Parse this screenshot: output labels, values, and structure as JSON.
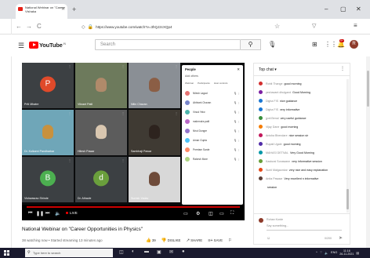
{
  "browser": {
    "tab_title_line1": "National Webinar on \"Career O",
    "tab_title_line2": "Vishaka",
    "new_tab_symbol": "+",
    "url": "https://www.youtube.com/watch?v=3hQJ2cXQp4",
    "window_controls": [
      "–",
      "▢",
      "✕"
    ],
    "nav": [
      "←",
      "→",
      "C"
    ]
  },
  "youtube": {
    "logo_text": "YouTube",
    "logo_country": "IN",
    "search_placeholder": "Search",
    "bell_badge": "9+",
    "avatar_letter": "R"
  },
  "video": {
    "live_label": "LIVE",
    "tiles": [
      {
        "name": "Priti Mhatre",
        "type": "avatar",
        "letter": "P",
        "color": "#e04a2a"
      },
      {
        "name": "Vikrant Patil",
        "type": "video",
        "bg": "#6d7a5c",
        "face": "#b08a6a"
      },
      {
        "name": "Nitin Chavan",
        "type": "video",
        "bg": "#8a8f95",
        "face": "#8b5e45"
      },
      {
        "name": "Dr. Kulkarni Pandharkar",
        "type": "video",
        "bg": "#6fa6b8",
        "face": "#c8913e"
      },
      {
        "name": "Hitesh Pawar",
        "type": "video",
        "bg": "#5c5c5c",
        "face": "#d9c7b0"
      },
      {
        "name": "Sambhaji Pawar",
        "type": "video",
        "bg": "#3f3a33",
        "face": "#2d231e"
      },
      {
        "name": "Vishwasrao Shinde",
        "type": "avatar",
        "letter": "B",
        "color": "#4caf50"
      },
      {
        "name": "Dr. Athavle",
        "type": "avatar",
        "letter": "d",
        "color": "#6a9f3c"
      },
      {
        "name": "Suresh Yadav",
        "type": "video",
        "bg": "#d8d8d8",
        "face": "#6e4b3a"
      }
    ],
    "participants_title": "People",
    "participants_sub": "Add others",
    "participants_tabs": [
      "Webinar",
      "Participants",
      "Host controls"
    ],
    "participants": [
      {
        "name": "Nilesh Lagad",
        "color": "#e57373"
      },
      {
        "name": "Abhisek Chavan",
        "color": "#7986cb"
      },
      {
        "name": "Vinod Yelw",
        "color": "#4db6ac"
      },
      {
        "name": "mahendra patil",
        "color": "#ba68c8"
      },
      {
        "name": "Nirut Dongre",
        "color": "#9575cd"
      },
      {
        "name": "Aman Gupta",
        "color": "#4fc3f7"
      },
      {
        "name": "Preetam Sarde",
        "color": "#ff8a65"
      },
      {
        "name": "Rakesh More",
        "color": "#aed581"
      }
    ]
  },
  "info": {
    "title": "National Webinar on \"Career Opportunities in Physics\"",
    "meta": "38 watching now • Started streaming 13 minutes ago",
    "likes": "39",
    "dislike_label": "DISLIKE",
    "share_label": "SHARE",
    "save_label": "SAVE"
  },
  "chat": {
    "title": "Top chat",
    "messages": [
      {
        "name": "Rohit Thange",
        "text": "good morning",
        "color": "#d32f2f"
      },
      {
        "name": "yeshavant dhulgand",
        "text": "Good Morning",
        "color": "#7b1fa2"
      },
      {
        "name": "Digha FIS",
        "text": "nice guidance",
        "color": "#1976d2"
      },
      {
        "name": "Digha FIS",
        "text": "very informative",
        "color": "#1976d2"
      },
      {
        "name": "jyoti Benal",
        "text": "very useful guidance",
        "color": "#388e3c"
      },
      {
        "name": "Vijay Dane",
        "text": "good morning",
        "color": "#f57c00"
      },
      {
        "name": "Anisha Bhendare",
        "text": "nice session sir",
        "color": "#c2185b"
      },
      {
        "name": "Rupali Ugale",
        "text": "good morning",
        "color": "#512da8"
      },
      {
        "name": "MAHASI DETNAL",
        "text": "Very Good Morning",
        "color": "#0097a7"
      },
      {
        "name": "Kasturai Sonawane",
        "text": "very informative session",
        "color": "#689f38"
      },
      {
        "name": "Sunil Malgaonkar",
        "text": "very nice and easy explanation",
        "color": "#e64a19"
      },
      {
        "name": "Anita Pawaar",
        "text": "Very excellent n informative",
        "color": "#5d4037"
      },
      {
        "name": "",
        "text": "session",
        "color": ""
      }
    ],
    "me": "Rohan Korde",
    "input_placeholder": "Say something...",
    "char_count": "0/200"
  },
  "taskbar": {
    "search_placeholder": "Type here to search",
    "tray_lang": "ENG",
    "time": "11:16",
    "date": "26-11-2021"
  }
}
